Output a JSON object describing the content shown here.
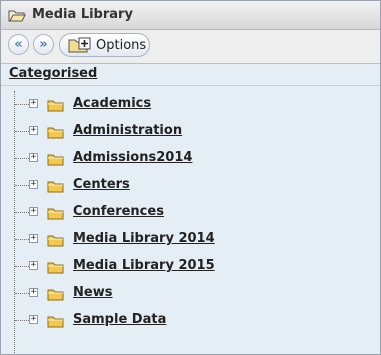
{
  "window": {
    "title": "Media Library"
  },
  "toolbar": {
    "prev_label": "«",
    "next_label": "»",
    "options_label": "Options"
  },
  "tree": {
    "root_label": "Categorised",
    "items": [
      {
        "label": "Academics"
      },
      {
        "label": "Administration"
      },
      {
        "label": "Admissions2014"
      },
      {
        "label": "Centers"
      },
      {
        "label": "Conferences"
      },
      {
        "label": "Media Library 2014"
      },
      {
        "label": "Media Library 2015"
      },
      {
        "label": "News"
      },
      {
        "label": "Sample Data"
      }
    ],
    "expand_symbol": "+"
  },
  "colors": {
    "folder": "#f2c94c",
    "accent": "#4b7fc0",
    "panel_bg": "#e6eef5"
  }
}
